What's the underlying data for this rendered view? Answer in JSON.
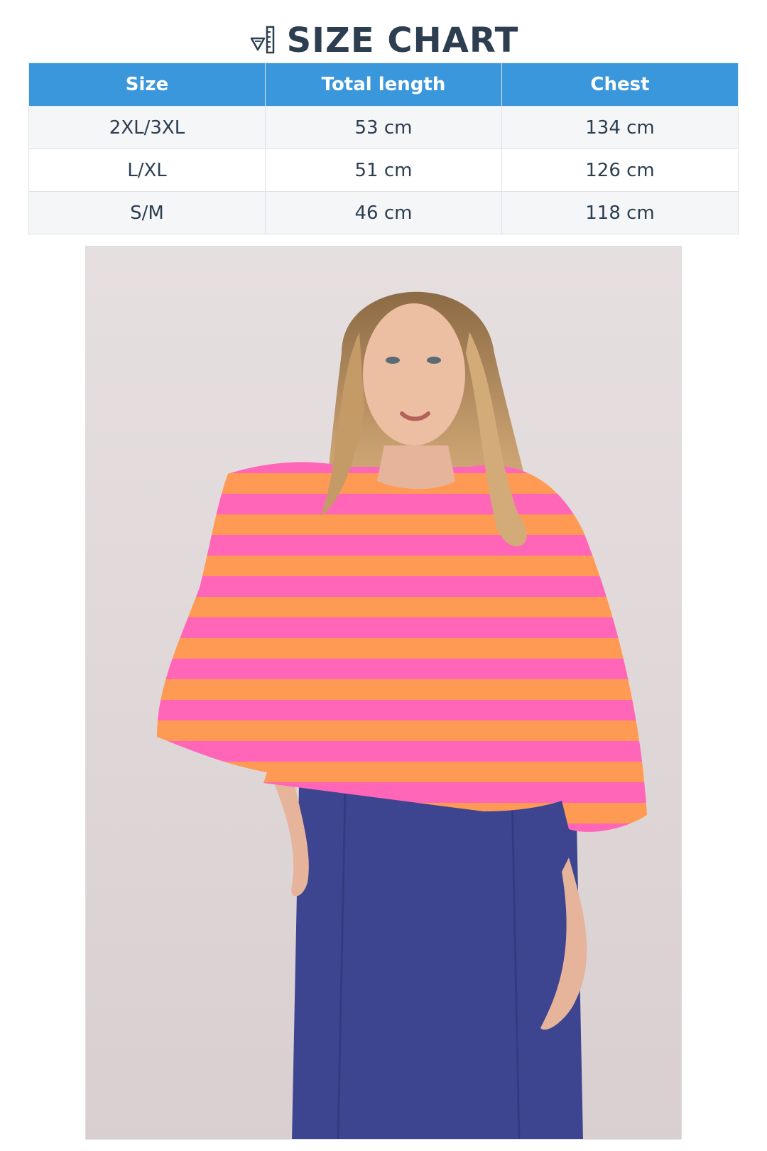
{
  "title": {
    "icon": "ruler-pencil-icon",
    "text": "SIZE CHART"
  },
  "table": {
    "headers": [
      "Size",
      "Total length",
      "Chest"
    ],
    "rows": [
      [
        "2XL/3XL",
        "53 cm",
        "134 cm"
      ],
      [
        "L/XL",
        "51 cm",
        "126 cm"
      ],
      [
        "S/M",
        "46 cm",
        "118 cm"
      ]
    ]
  },
  "colors": {
    "header_bg": "#3b97dc",
    "header_text": "#ffffff",
    "title_text": "#2c3e50",
    "row_alt": "#f5f6f8"
  },
  "photo": {
    "subject": "model-wearing-striped-cropped-top",
    "stripe_colors": [
      "#ff66b8",
      "#ff9a55"
    ],
    "skirt_color": "#3d4591",
    "background": "#e4dcdd"
  }
}
